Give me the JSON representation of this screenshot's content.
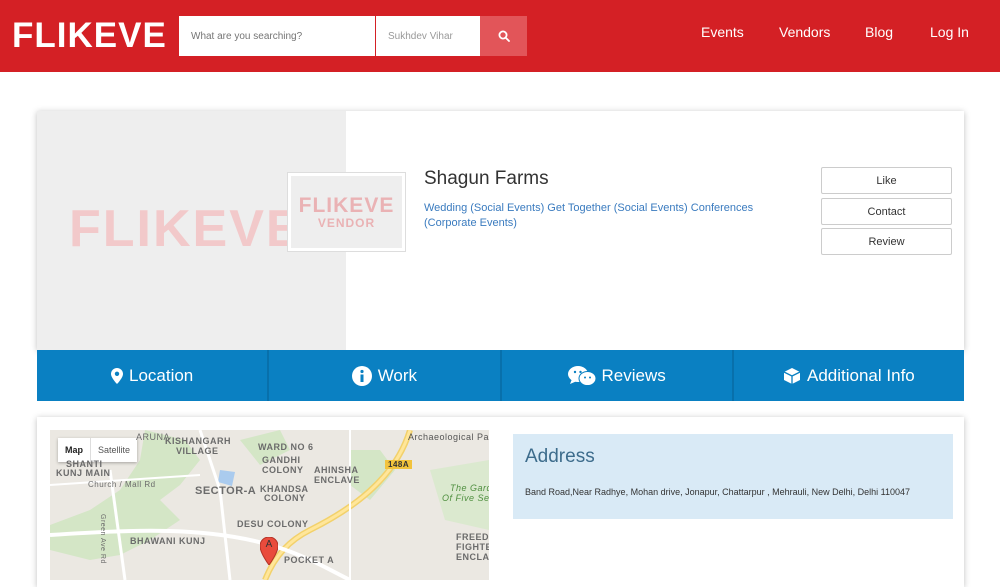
{
  "header": {
    "logo_text": "FLIKEVE",
    "search_placeholder": "What are you searching?",
    "location_value": "Sukhdev Vihar",
    "nav": [
      "Events",
      "Vendors",
      "Blog",
      "Log In"
    ]
  },
  "vendor": {
    "cover_logo": "FLIKEVE",
    "thumb_logo": "FLIKEVE",
    "thumb_sub": "VENDOR",
    "name": "Shagun Farms",
    "categories": "Wedding (Social Events) Get Together (Social Events) Conferences (Corporate Events)",
    "buttons": {
      "like": "Like",
      "contact": "Contact",
      "review": "Review"
    }
  },
  "tabs": [
    "Location",
    "Work",
    "Reviews",
    "Additional Info"
  ],
  "map": {
    "toggle_map": "Map",
    "toggle_satellite": "Satellite",
    "labels": [
      "ARUNA",
      "KISHANGARH",
      "VILLAGE",
      "WARD NO 6",
      "Archaeological Pa",
      "SHANTI",
      "KUNJ MAIN",
      "GANDHI",
      "COLONY",
      "AHINSHA",
      "ENCLAVE",
      "148A",
      "Church / Mall Rd",
      "SECTOR-A",
      "KHANDSA",
      "COLONY",
      "The Garde",
      "Of Five Sen",
      "DESU COLONY",
      "BHAWANI KUNJ",
      "FREED",
      "FIGHTE",
      "ENCLA",
      "POCKET A",
      "Green Ave Rd"
    ],
    "marker": "A"
  },
  "address": {
    "title": "Address",
    "text": "Band Road,Near Radhye, Mohan drive, Jonapur, Chattarpur , Mehrauli, New Delhi, Delhi 110047"
  },
  "colors": {
    "brand_red": "#d42025",
    "tab_blue": "#0a80c2",
    "link_blue": "#3a7bbf",
    "address_bg": "#d9eaf6"
  }
}
